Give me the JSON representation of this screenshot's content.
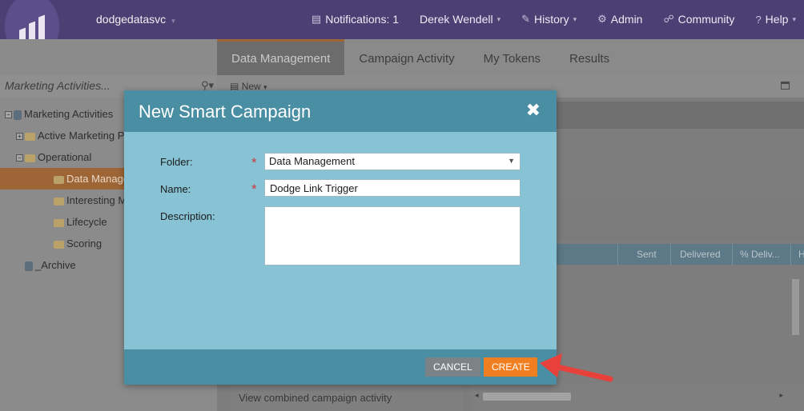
{
  "topbar": {
    "account": "dodgedatasvc",
    "nav": [
      {
        "icon": "notebook-icon",
        "label": "Notifications: 1",
        "caret": false
      },
      {
        "icon": "",
        "label": "Derek Wendell",
        "caret": true
      },
      {
        "icon": "wand-icon",
        "label": "History",
        "caret": true
      },
      {
        "icon": "gear-icon",
        "label": "Admin",
        "caret": false
      },
      {
        "icon": "people-icon",
        "label": "Community",
        "caret": false
      },
      {
        "icon": "help-icon",
        "label": "Help",
        "caret": true
      }
    ]
  },
  "left_panel": {
    "search_placeholder": "Marketing Activities...",
    "tree": [
      {
        "label": "Marketing Activities",
        "indent": 0,
        "toggle": "⊟",
        "icon": "database-icon",
        "selected": false
      },
      {
        "label": "Active Marketing P",
        "indent": 1,
        "toggle": "⊞",
        "icon": "folder-icon",
        "selected": false
      },
      {
        "label": "Operational",
        "indent": 1,
        "toggle": "⊟",
        "icon": "folder-icon",
        "selected": false
      },
      {
        "label": "Data Manageme",
        "indent": 2,
        "toggle": "",
        "icon": "folder-icon",
        "selected": true
      },
      {
        "label": "Interesting Mon",
        "indent": 2,
        "toggle": "",
        "icon": "folder-icon",
        "selected": false
      },
      {
        "label": "Lifecycle",
        "indent": 2,
        "toggle": "",
        "icon": "folder-icon",
        "selected": false
      },
      {
        "label": "Scoring",
        "indent": 2,
        "toggle": "",
        "icon": "folder-icon",
        "selected": false
      },
      {
        "label": "_Archive",
        "indent": 1,
        "toggle": "",
        "icon": "archive-icon",
        "selected": false
      }
    ]
  },
  "main": {
    "tabs": [
      {
        "label": "Data Management",
        "active": true
      },
      {
        "label": "Campaign Activity",
        "active": false
      },
      {
        "label": "My Tokens",
        "active": false
      },
      {
        "label": "Results",
        "active": false
      }
    ],
    "toolbar_new": "New",
    "grid_columns": [
      "Sent",
      "Delivered",
      "% Deliv...",
      "H"
    ],
    "bottom_link": "View combined campaign activity"
  },
  "modal": {
    "title": "New Smart Campaign",
    "close_glyph": "✖",
    "folder_label": "Folder:",
    "folder_value": "Data Management",
    "name_label": "Name:",
    "name_value": "Dodge Link Trigger",
    "description_label": "Description:",
    "description_value": "",
    "required_mark": "*",
    "cancel_label": "CANCEL",
    "create_label": "CREATE"
  },
  "colors": {
    "topbar": "#4b3f74",
    "modal_header": "#4a8ea3",
    "modal_body": "#87c2d5",
    "create_button": "#f07f22",
    "cancel_button": "#7c8388",
    "annotation_arrow": "#e8413c"
  }
}
